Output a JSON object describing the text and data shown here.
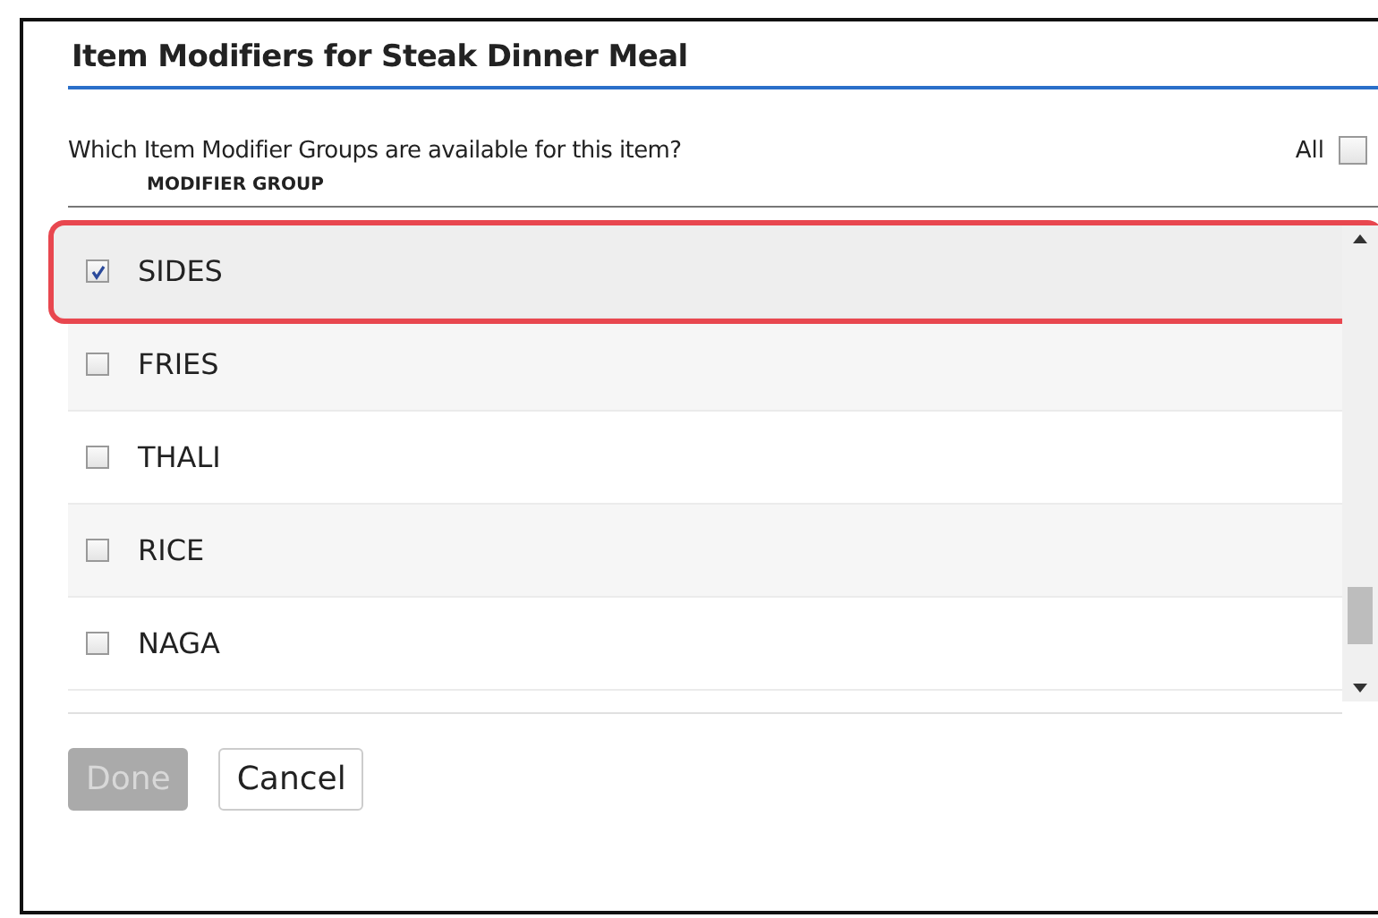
{
  "dialog": {
    "title": "Item Modifiers for Steak Dinner Meal",
    "question": "Which Item Modifier Groups are available for this item?",
    "all": {
      "label": "All",
      "checked": false
    },
    "column_header": "MODIFIER GROUP",
    "rows": [
      {
        "name": "SIDES",
        "checked": true,
        "highlighted": true
      },
      {
        "name": "FRIES",
        "checked": false,
        "highlighted": false
      },
      {
        "name": "THALI",
        "checked": false,
        "highlighted": false
      },
      {
        "name": "RICE",
        "checked": false,
        "highlighted": false
      },
      {
        "name": "NAGA",
        "checked": false,
        "highlighted": false
      }
    ],
    "buttons": [
      {
        "label": "Done",
        "disabled": true
      },
      {
        "label": "Cancel",
        "disabled": false
      }
    ]
  }
}
